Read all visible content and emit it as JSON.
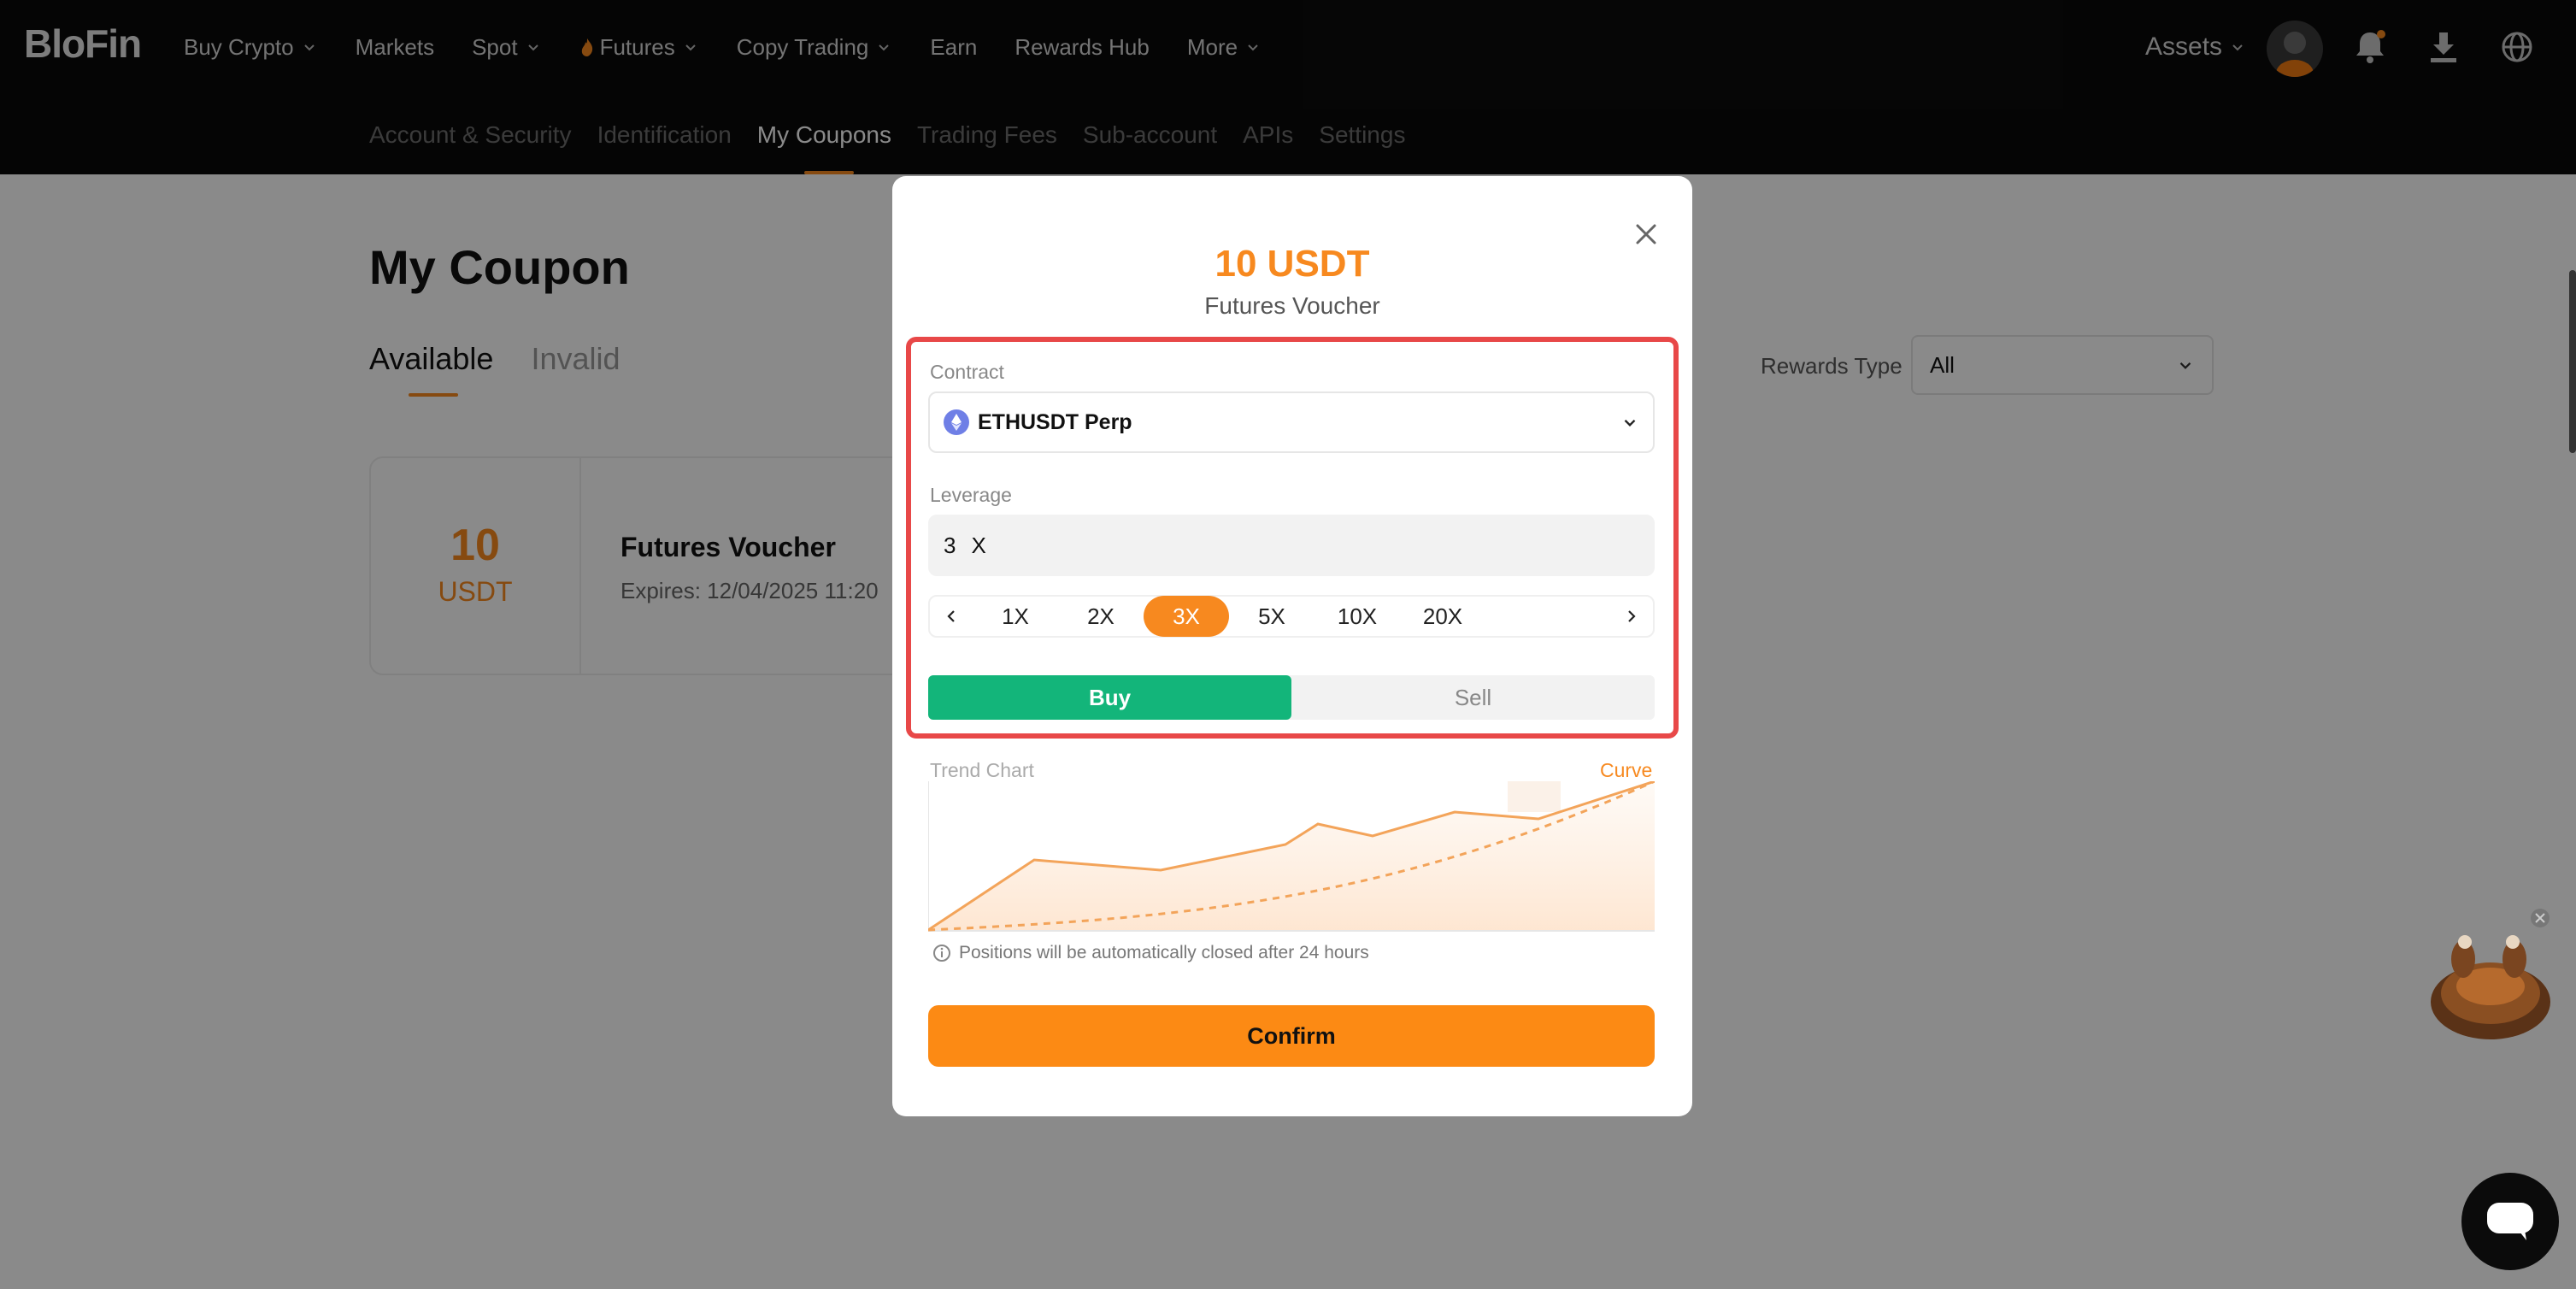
{
  "brand": {
    "logo_text": "BloFin",
    "accent": "#f7891f",
    "buy_color": "#13b57a",
    "highlight_color": "#e84848"
  },
  "nav": {
    "items": [
      {
        "label": "Buy Crypto",
        "dropdown": true
      },
      {
        "label": "Markets",
        "dropdown": false
      },
      {
        "label": "Spot",
        "dropdown": true
      },
      {
        "label": "Futures",
        "dropdown": true,
        "icon": "fire-icon"
      },
      {
        "label": "Copy Trading",
        "dropdown": true
      },
      {
        "label": "Earn",
        "dropdown": false
      },
      {
        "label": "Rewards Hub",
        "dropdown": false
      },
      {
        "label": "More",
        "dropdown": true
      }
    ],
    "assets_label": "Assets",
    "icons": [
      "avatar",
      "bell-icon",
      "download-icon",
      "globe-icon"
    ]
  },
  "subnav": {
    "items": [
      "Account & Security",
      "Identification",
      "My Coupons",
      "Trading Fees",
      "Sub-account",
      "APIs",
      "Settings"
    ],
    "active": "My Coupons"
  },
  "page": {
    "title": "My Coupon",
    "tabs": [
      "Available",
      "Invalid"
    ],
    "active_tab": "Available",
    "filter_label": "Rewards Type",
    "filter_value": "All",
    "coupon": {
      "amount": "10",
      "currency": "USDT",
      "name": "Futures Voucher",
      "expires": "Expires: 12/04/2025 11:20"
    }
  },
  "modal": {
    "amount": "10 USDT",
    "subtitle": "Futures Voucher",
    "contract_label": "Contract",
    "contract_value": "ETHUSDT Perp",
    "leverage_label": "Leverage",
    "leverage_value": "3",
    "leverage_unit": "X",
    "leverage_options": [
      "1X",
      "2X",
      "3X",
      "5X",
      "10X",
      "20X"
    ],
    "leverage_selected": "3X",
    "side_options": [
      "Buy",
      "Sell"
    ],
    "side_selected": "Buy",
    "trend_label": "Trend Chart",
    "curve_label": "Curve",
    "notice": "Positions will be automatically closed after 24 hours",
    "confirm_label": "Confirm"
  }
}
